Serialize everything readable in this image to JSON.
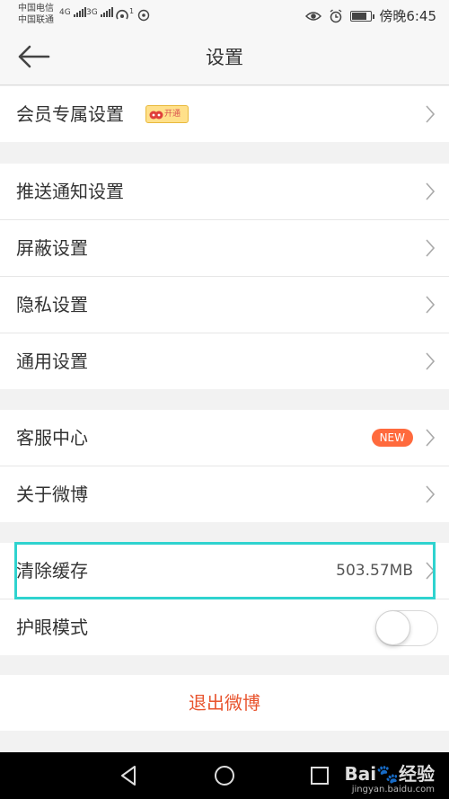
{
  "status_bar": {
    "carrier1": "中国电信",
    "carrier2": "中国联通",
    "net1": "4G",
    "net2": "3G",
    "hotspot_count": "1",
    "time": "傍晚6:45"
  },
  "header": {
    "title": "设置"
  },
  "groups": {
    "vip": {
      "label": "会员专属设置",
      "badge": "开通"
    },
    "notify": {
      "label": "推送通知设置"
    },
    "block": {
      "label": "屏蔽设置"
    },
    "privacy": {
      "label": "隐私设置"
    },
    "general": {
      "label": "通用设置"
    },
    "service": {
      "label": "客服中心",
      "badge": "NEW"
    },
    "about": {
      "label": "关于微博"
    },
    "cache": {
      "label": "清除缓存",
      "value": "503.57MB"
    },
    "eyecare": {
      "label": "护眼模式",
      "enabled": false
    },
    "logout": {
      "label": "退出微博"
    }
  },
  "watermark": {
    "brand": "Bai",
    "suffix": "经验",
    "url": "jingyan.baidu.com"
  },
  "colors": {
    "accent_red": "#e8542e",
    "new_badge": "#ff6a3d",
    "highlight": "#2fd3cf"
  }
}
